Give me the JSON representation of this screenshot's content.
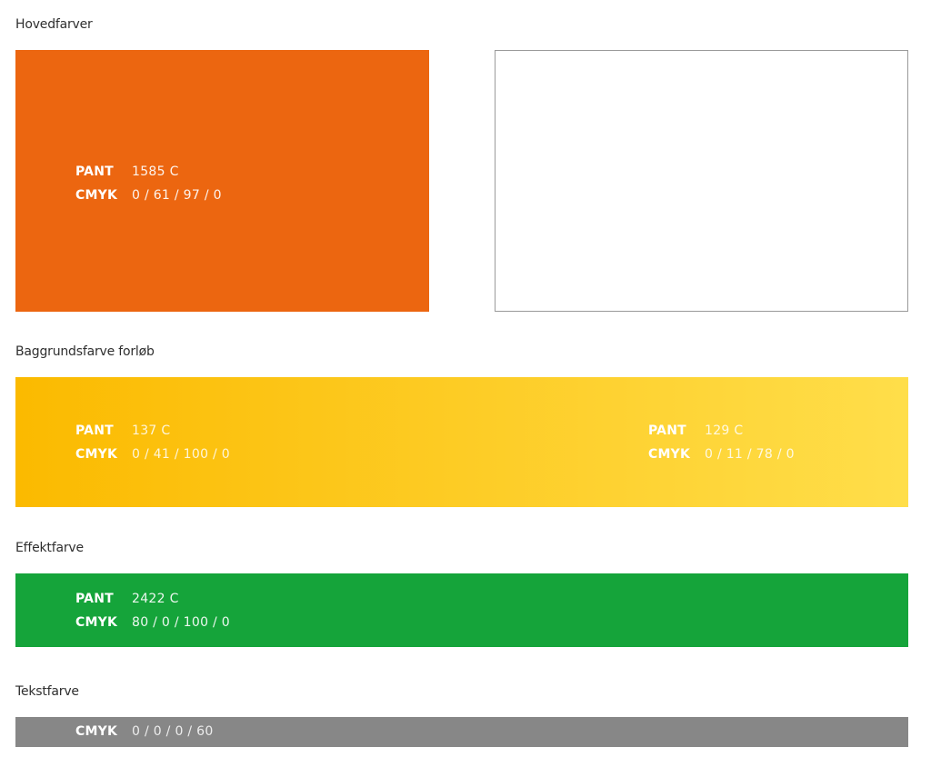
{
  "colors": {
    "main_orange": "#EC6610",
    "white_swatch_border": "#9A9A9A",
    "gradient_start": "#FBBA00",
    "gradient_end": "#FFDE4A",
    "effect_green": "#15A43A",
    "text_gray": "#878787"
  },
  "sections": {
    "main": {
      "heading": "Hovedfarver",
      "orange": {
        "pant_label": "PANT",
        "pant_value": "1585 C",
        "cmyk_label": "CMYK",
        "cmyk_value": "0 / 61 / 97 / 0"
      }
    },
    "background": {
      "heading": "Baggrundsfarve forløb",
      "start": {
        "pant_label": "PANT",
        "pant_value": "137 C",
        "cmyk_label": "CMYK",
        "cmyk_value": "0 / 41 / 100 / 0"
      },
      "end": {
        "pant_label": "PANT",
        "pant_value": "129 C",
        "cmyk_label": "CMYK",
        "cmyk_value": "0 / 11 / 78 / 0"
      }
    },
    "effect": {
      "heading": "Effektfarve",
      "green": {
        "pant_label": "PANT",
        "pant_value": "2422 C",
        "cmyk_label": "CMYK",
        "cmyk_value": "80 / 0 / 100 / 0"
      }
    },
    "text": {
      "heading": "Tekstfarve",
      "gray": {
        "cmyk_label": "CMYK",
        "cmyk_value": "0 / 0 / 0 / 60"
      }
    }
  }
}
